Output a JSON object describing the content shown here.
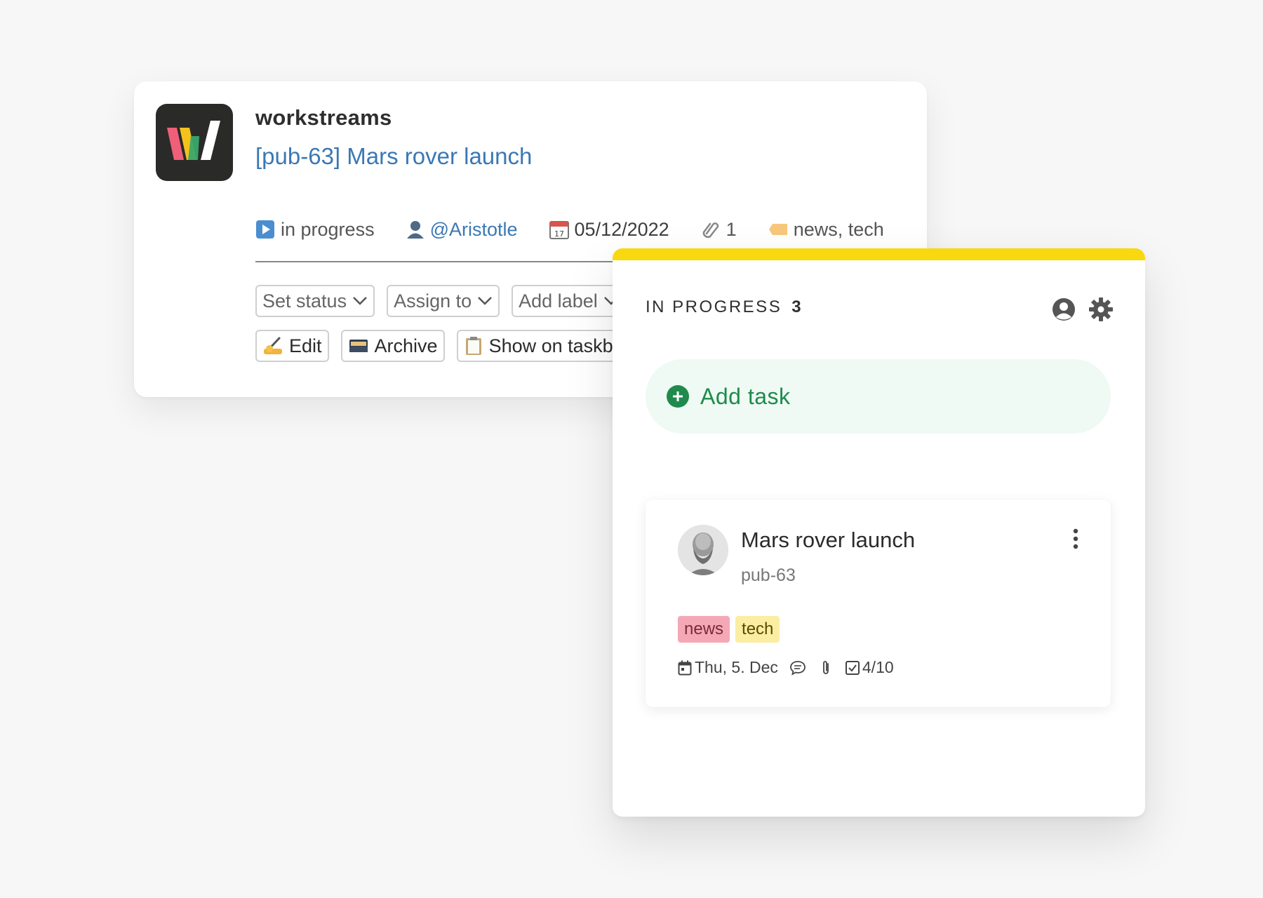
{
  "message": {
    "app_name": "workstreams",
    "title": "[pub-63] Mars rover launch",
    "meta": {
      "status": "in progress",
      "assignee": "@Aristotle",
      "date": "05/12/2022",
      "attachments": "1",
      "labels": "news, tech"
    },
    "controls": {
      "set_status": "Set status",
      "assign_to": "Assign to",
      "add_label": "Add label"
    },
    "actions": {
      "edit": "Edit",
      "archive": "Archive",
      "show_on_taskboard": "Show on taskbo"
    }
  },
  "board_column": {
    "title": "IN PROGRESS",
    "count": "3",
    "accent_color": "#f8d90f",
    "add_task_label": "Add task",
    "task": {
      "title": "Mars rover launch",
      "id": "pub-63",
      "tags": [
        "news",
        "tech"
      ],
      "due": "Thu, 5. Dec",
      "checklist": "4/10"
    }
  },
  "colors": {
    "link": "#3b78b4",
    "add_task_green": "#1f8a4c",
    "tag_news": "#f4a8b6",
    "tag_tech": "#fbeea2"
  }
}
